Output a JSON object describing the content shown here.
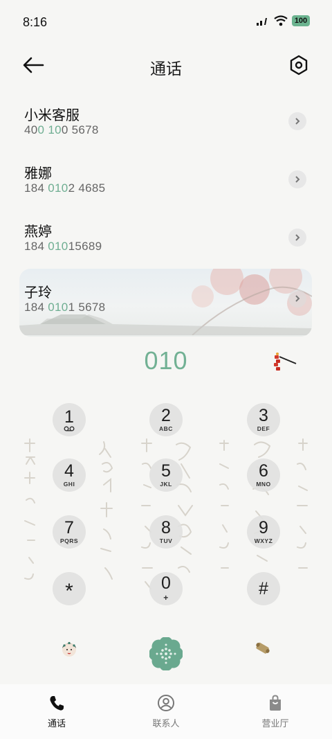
{
  "status_bar": {
    "time": "8:16",
    "battery": "100"
  },
  "header": {
    "title": "通话"
  },
  "contacts": [
    {
      "name": "小米客服",
      "num_pre": "40",
      "num_hl1": "0",
      "num_mid": " ",
      "num_hl2": "10",
      "num_post": "0 5678"
    },
    {
      "name": "雅娜",
      "num_pre": "184 ",
      "num_hl1": "010",
      "num_mid": "",
      "num_hl2": "",
      "num_post": "2 4685"
    },
    {
      "name": "燕婷",
      "num_pre": "184 ",
      "num_hl1": "010",
      "num_mid": "",
      "num_hl2": "",
      "num_post": "15689"
    },
    {
      "name": "子玲",
      "num_pre": "184 ",
      "num_hl1": "010",
      "num_mid": "",
      "num_hl2": "",
      "num_post": "1 5678"
    }
  ],
  "dialed_number": "010",
  "keypad": {
    "k1": {
      "digit": "1",
      "letters": ""
    },
    "k2": {
      "digit": "2",
      "letters": "ABC"
    },
    "k3": {
      "digit": "3",
      "letters": "DEF"
    },
    "k4": {
      "digit": "4",
      "letters": "GHI"
    },
    "k5": {
      "digit": "5",
      "letters": "JKL"
    },
    "k6": {
      "digit": "6",
      "letters": "MNO"
    },
    "k7": {
      "digit": "7",
      "letters": "PQRS"
    },
    "k8": {
      "digit": "8",
      "letters": "TUV"
    },
    "k9": {
      "digit": "9",
      "letters": "WXYZ"
    },
    "kstar": {
      "digit": "*",
      "letters": ""
    },
    "k0": {
      "digit": "0",
      "letters": "+"
    },
    "khash": {
      "digit": "#",
      "letters": ""
    }
  },
  "bottom_nav": {
    "calls": "通话",
    "contacts": "联系人",
    "store": "营业厅"
  },
  "colors": {
    "accent": "#72b194",
    "call_button": "#6aa98f",
    "background": "#f6f6f4"
  },
  "icons": {
    "back": "arrow-left-icon",
    "settings": "hexagon-settings-icon",
    "chevron": "chevron-right-icon",
    "voicemail": "voicemail-icon",
    "firecracker": "firecracker-icon",
    "avatar": "opera-avatar-icon",
    "call": "flower-call-icon",
    "scroll": "scroll-icon",
    "nav_calls": "phone-icon",
    "nav_contacts": "person-icon",
    "nav_store": "bag-icon"
  }
}
